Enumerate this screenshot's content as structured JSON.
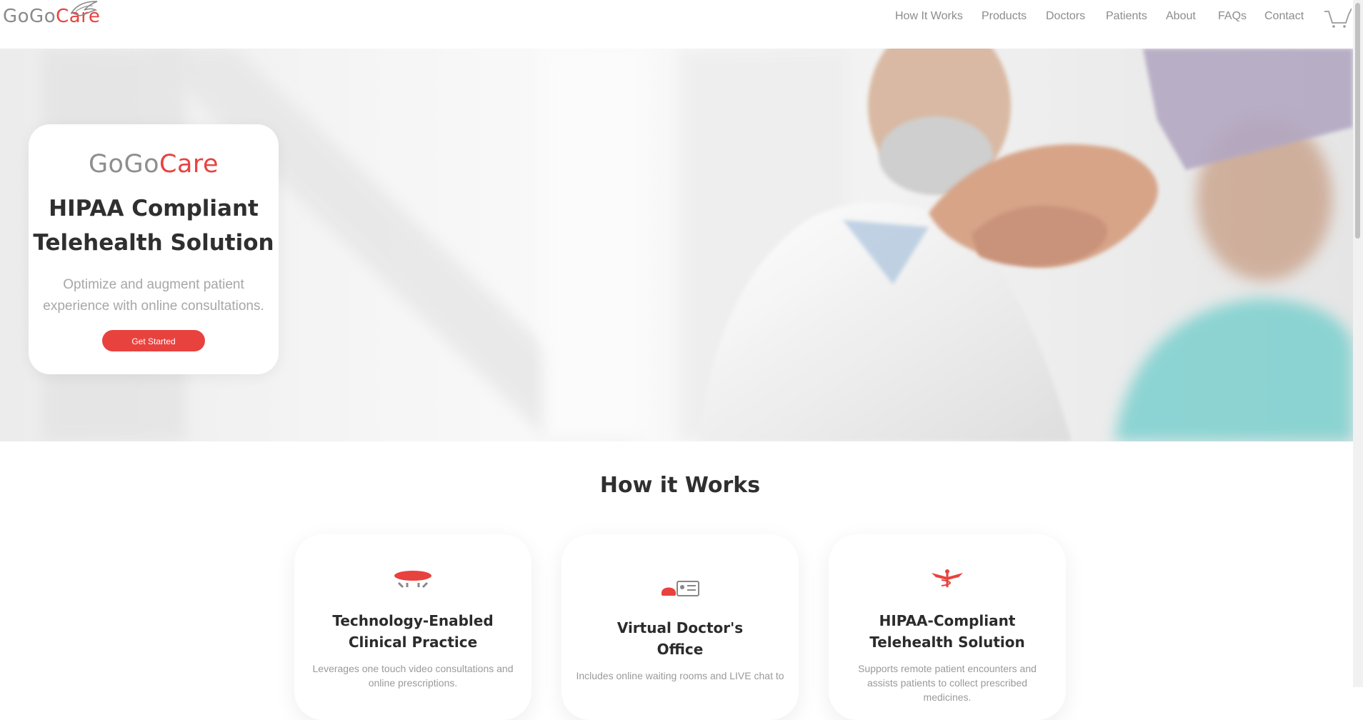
{
  "brand": {
    "logo_gogo": "GoGo",
    "logo_care": "Care"
  },
  "nav": {
    "items": [
      "How It Works",
      "Products",
      "Doctors",
      "Patients",
      "About",
      "FAQs",
      "Contact"
    ],
    "cart_icon": "cart-icon"
  },
  "hero": {
    "logo_gogo": "GoGo",
    "logo_care": "Care",
    "title_line1": "HIPAA Compliant",
    "title_line2": "Telehealth Solution",
    "subtitle_line1": "Optimize and augment patient",
    "subtitle_line2": "experience with online consultations.",
    "cta_label": "Get Started"
  },
  "how": {
    "title": "How it Works",
    "cards": [
      {
        "icon": "doctor-hat-icon",
        "title_line1": "Technology-Enabled",
        "title_line2": "Clinical Practice",
        "text_line1": "Leverages one touch video consultations and",
        "text_line2": "online prescriptions."
      },
      {
        "icon": "phone-card-icon",
        "title_line1": "Virtual Doctor's",
        "title_line2": "Office",
        "text_line1": "Includes online waiting rooms and LIVE chat to",
        "text_line2": ""
      },
      {
        "icon": "caduceus-icon",
        "title_line1": "HIPAA-Compliant",
        "title_line2": "Telehealth Solution",
        "text_line1": "Supports remote patient encounters and",
        "text_line2": "assists patients to collect prescribed medicines."
      }
    ]
  },
  "colors": {
    "accent": "#e8423f",
    "logo_gray": "#8a8a8a",
    "nav_text": "#8c8c8c"
  }
}
